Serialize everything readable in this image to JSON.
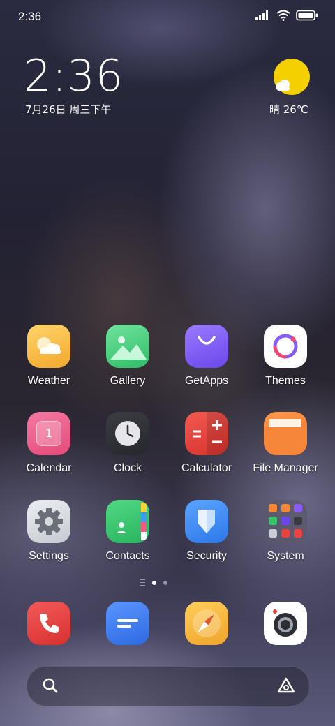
{
  "status_bar": {
    "time": "2:36",
    "icons": [
      "signal-icon",
      "wifi-icon",
      "battery-icon"
    ]
  },
  "clock_widget": {
    "time": "2:36",
    "date": "7月26日 周三下午"
  },
  "weather_widget": {
    "condition_temp": "晴 26℃",
    "icon": "sunny-cloud-icon"
  },
  "apps": [
    {
      "label": "Weather",
      "icon": "weather-icon",
      "color": "#f5b93a"
    },
    {
      "label": "Gallery",
      "icon": "gallery-icon",
      "color": "#3fcf7a"
    },
    {
      "label": "GetApps",
      "icon": "getapps-icon",
      "color": "#7a5cf2"
    },
    {
      "label": "Themes",
      "icon": "themes-icon",
      "color": "#ffffff"
    },
    {
      "label": "Calendar",
      "icon": "calendar-icon",
      "color": "#ec5c8a",
      "badge": "1"
    },
    {
      "label": "Clock",
      "icon": "clock-icon",
      "color": "#2f3035"
    },
    {
      "label": "Calculator",
      "icon": "calculator-icon",
      "color": "#e8423c"
    },
    {
      "label": "File Manager",
      "icon": "file-manager-icon",
      "color": "#f27f30"
    },
    {
      "label": "Settings",
      "icon": "settings-icon",
      "color": "#d6d8de"
    },
    {
      "label": "Contacts",
      "icon": "contacts-icon",
      "color": "#35c46c"
    },
    {
      "label": "Security",
      "icon": "security-icon",
      "color": "#3d8cf2"
    },
    {
      "label": "System",
      "icon": "folder-icon",
      "color": "#4a4a55"
    }
  ],
  "page_indicator": {
    "pages": 3,
    "current": 2
  },
  "dock": [
    {
      "icon": "phone-icon",
      "color": "#ee4242"
    },
    {
      "icon": "messages-icon",
      "color": "#3d7cef"
    },
    {
      "icon": "browser-icon",
      "color": "#f5b32f"
    },
    {
      "icon": "camera-icon",
      "color": "#ffffff"
    }
  ],
  "search_bar": {
    "left_icon": "search-icon",
    "right_icon": "assistant-icon"
  }
}
